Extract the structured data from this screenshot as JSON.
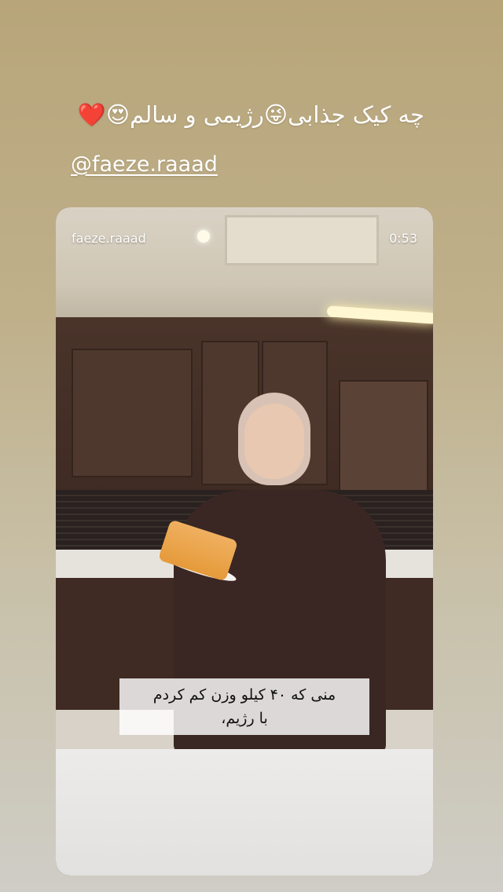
{
  "story": {
    "caption": "چه کیک جذابی😜رژیمی و سالم😍❤️",
    "mention": "@faeze.raaad"
  },
  "video": {
    "username": "faeze.raaad",
    "timer": "0:53",
    "subtitle_line1": "منی که ۴۰ کیلو وزن کم کردم",
    "subtitle_line2": "با رژیم،"
  }
}
